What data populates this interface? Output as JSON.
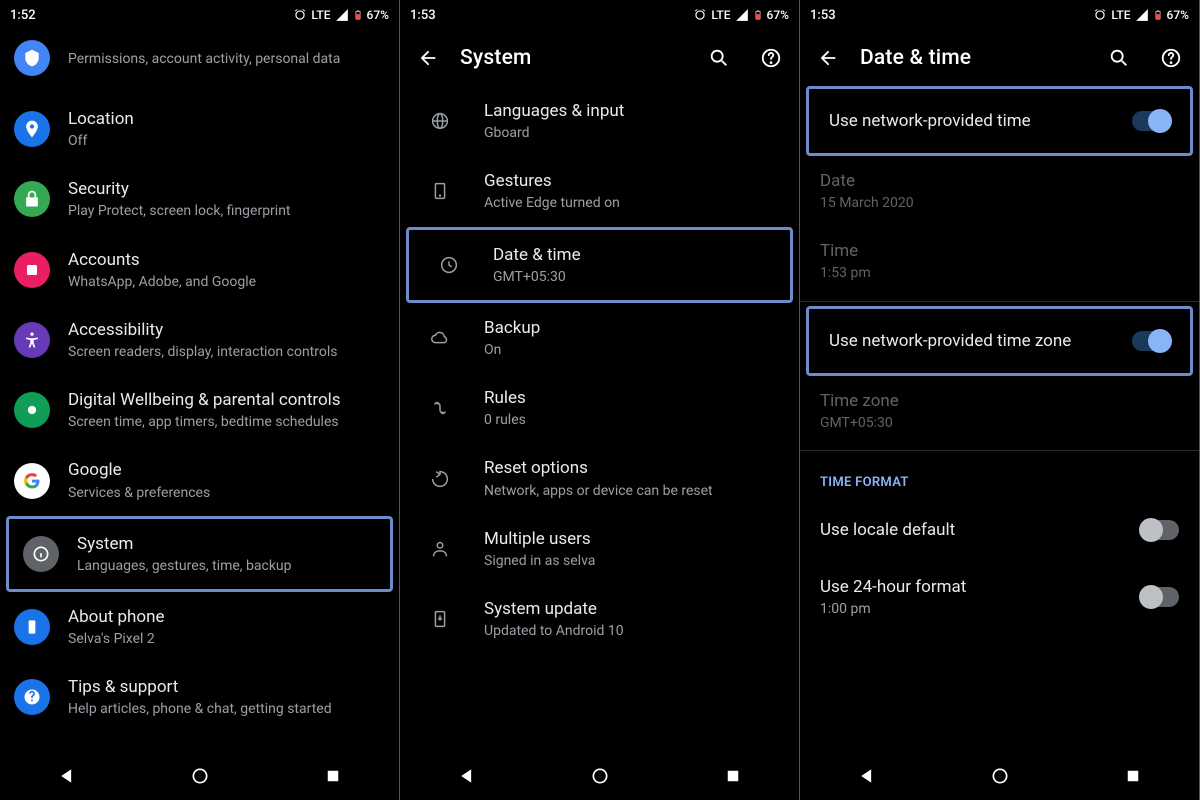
{
  "statusbar": {
    "clock1": "1:52",
    "clock23": "1:53",
    "network": "LTE",
    "battery": "67%"
  },
  "panel1": {
    "items": [
      {
        "title": "",
        "sub": "Permissions, account activity, personal data",
        "color": "#4285f4"
      },
      {
        "title": "Location",
        "sub": "Off",
        "color": "#1a73e8"
      },
      {
        "title": "Security",
        "sub": "Play Protect, screen lock, fingerprint",
        "color": "#34a853"
      },
      {
        "title": "Accounts",
        "sub": "WhatsApp, Adobe, and Google",
        "color": "#e91e63"
      },
      {
        "title": "Accessibility",
        "sub": "Screen readers, display, interaction controls",
        "color": "#673ab7"
      },
      {
        "title": "Digital Wellbeing & parental controls",
        "sub": "Screen time, app timers, bedtime schedules",
        "color": "#0f9d58"
      },
      {
        "title": "Google",
        "sub": "Services & preferences",
        "color": "#fff"
      },
      {
        "title": "System",
        "sub": "Languages, gestures, time, backup",
        "color": "#5f6368"
      },
      {
        "title": "About phone",
        "sub": "Selva's Pixel 2",
        "color": "#1a73e8"
      },
      {
        "title": "Tips & support",
        "sub": "Help articles, phone & chat, getting started",
        "color": "#1a73e8"
      }
    ]
  },
  "panel2": {
    "title": "System",
    "items": [
      {
        "title": "Languages & input",
        "sub": "Gboard"
      },
      {
        "title": "Gestures",
        "sub": "Active Edge turned on"
      },
      {
        "title": "Date & time",
        "sub": "GMT+05:30"
      },
      {
        "title": "Backup",
        "sub": "On"
      },
      {
        "title": "Rules",
        "sub": "0 rules"
      },
      {
        "title": "Reset options",
        "sub": "Network, apps or device can be reset"
      },
      {
        "title": "Multiple users",
        "sub": "Signed in as selva"
      },
      {
        "title": "System update",
        "sub": "Updated to Android 10"
      }
    ]
  },
  "panel3": {
    "title": "Date & time",
    "use_net_time": "Use network-provided time",
    "date_label": "Date",
    "date_val": "15 March 2020",
    "time_label": "Time",
    "time_val": "1:53 pm",
    "use_net_tz": "Use network-provided time zone",
    "tz_label": "Time zone",
    "tz_val": "GMT+05:30",
    "section": "TIME FORMAT",
    "locale": "Use locale default",
    "h24": "Use 24-hour format",
    "h24_sub": "1:00 pm"
  }
}
